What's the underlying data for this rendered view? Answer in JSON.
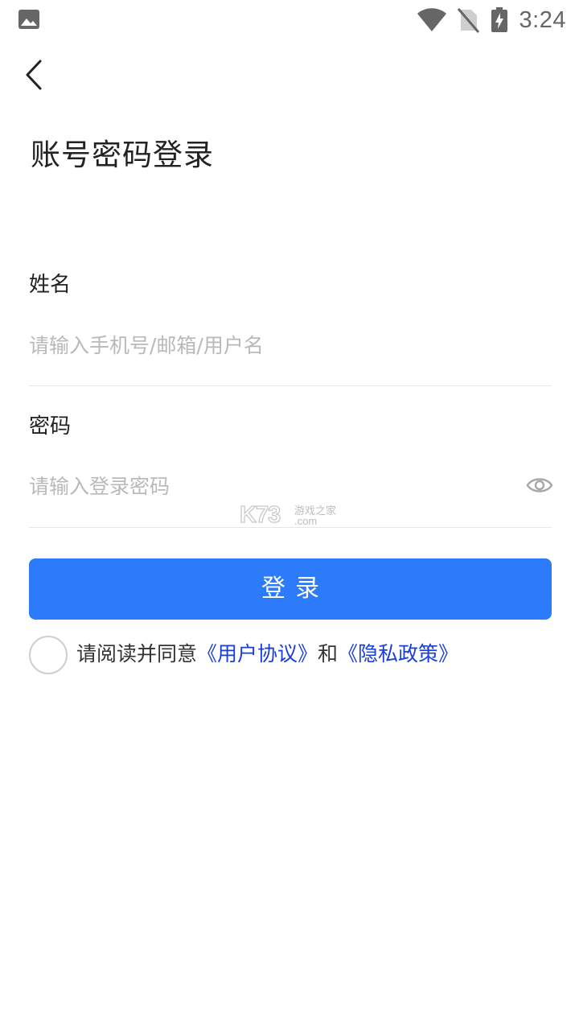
{
  "status_bar": {
    "time": "3:24",
    "icons": [
      "image-icon",
      "wifi-icon",
      "no-sim-icon",
      "battery-charging-icon"
    ]
  },
  "nav": {
    "back_icon": "chevron-left-icon"
  },
  "title": "账号密码登录",
  "form": {
    "name_label": "姓名",
    "name_placeholder": "请输入手机号/邮箱/用户名",
    "password_label": "密码",
    "password_placeholder": "请输入登录密码",
    "eye_icon": "eye-icon"
  },
  "login_button": "登录",
  "agreement": {
    "prefix": "请阅读并同意",
    "user_agreement": "《用户协议》",
    "and": "和",
    "privacy_policy": "《隐私政策》"
  },
  "watermark": {
    "logo": "K73",
    "site_name": "游戏之家",
    "domain": ".com"
  },
  "colors": {
    "primary": "#2b7bfb",
    "link": "#1a3fd8",
    "placeholder": "#b9b9b9",
    "divider": "#e6e6e6"
  }
}
